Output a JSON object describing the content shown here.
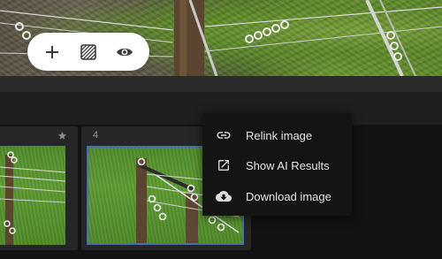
{
  "toolbar": {
    "add_icon": "plus-icon",
    "pattern_icon": "hatch-pattern-icon",
    "view_icon": "eye-icon"
  },
  "filmstrip": {
    "cards": [
      {
        "number": "",
        "starred_icon": "star-icon"
      },
      {
        "number": "4"
      }
    ],
    "selected_border_color": "#4a6fb0"
  },
  "context_menu": {
    "items": [
      {
        "label": "Relink image",
        "icon": "link-icon"
      },
      {
        "label": "Show AI Results",
        "icon": "open-in-new-icon"
      },
      {
        "label": "Download image",
        "icon": "cloud-download-icon"
      }
    ]
  },
  "colors": {
    "menu_bg": "#141414",
    "menu_text": "#e6e6e6",
    "panel_bg": "#1f1f1f"
  }
}
